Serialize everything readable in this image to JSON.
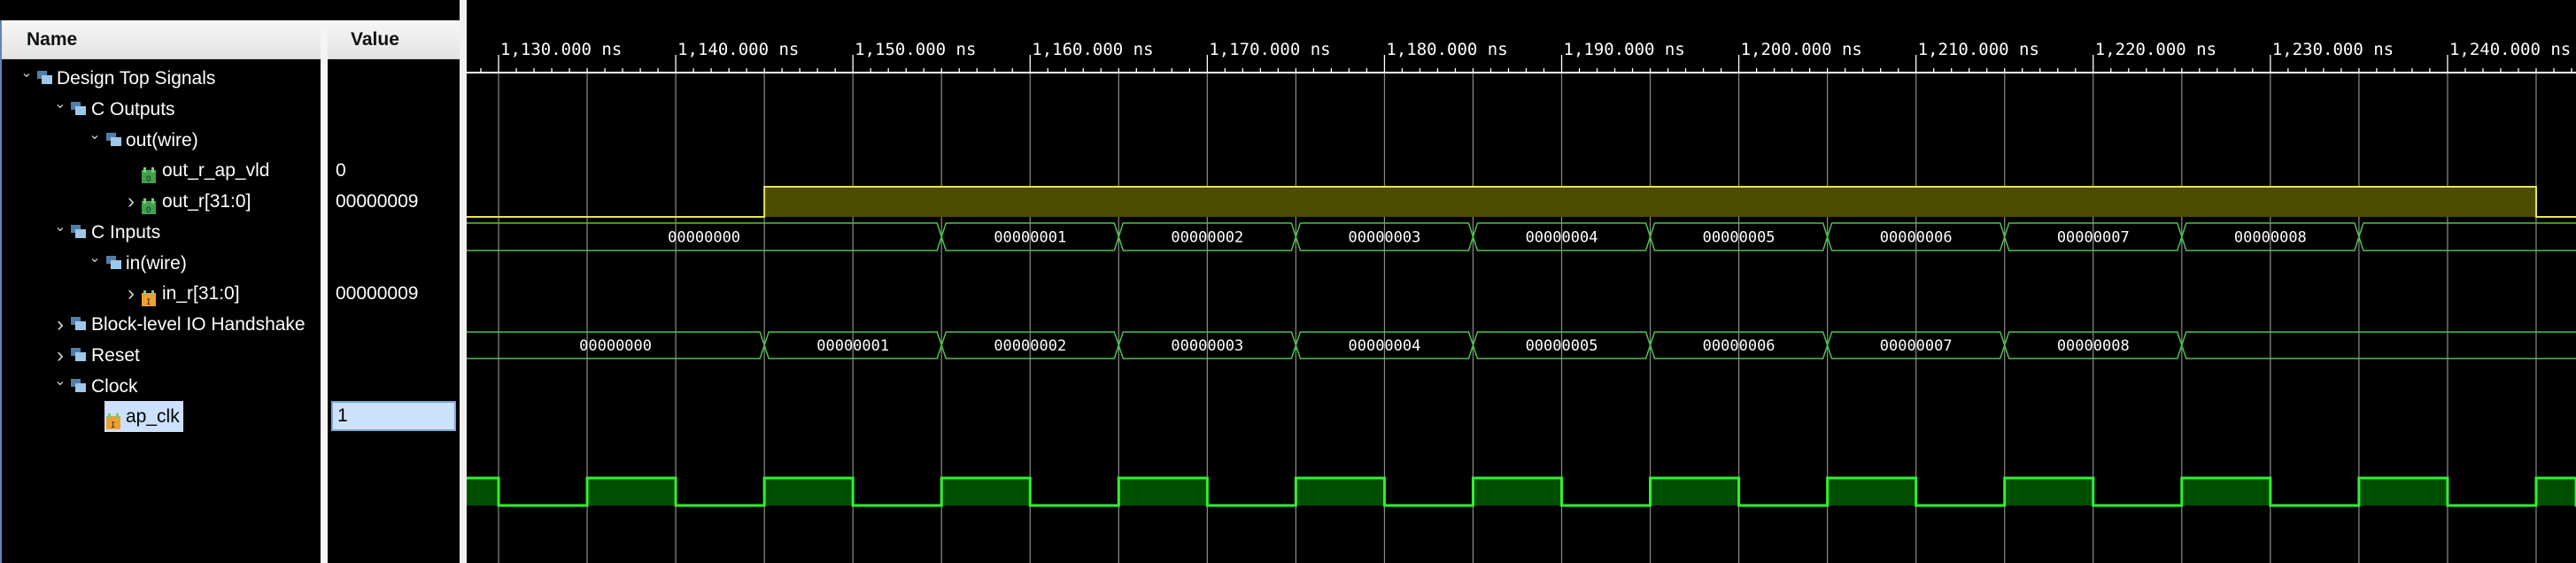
{
  "columns": {
    "name": "Name",
    "value": "Value"
  },
  "tree": [
    {
      "label": "Design Top Signals",
      "level": 0,
      "expander": "expanded",
      "icon": "group-icon"
    },
    {
      "label": "C Outputs",
      "level": 1,
      "expander": "expanded",
      "icon": "group-icon"
    },
    {
      "label": "out(wire)",
      "level": 2,
      "expander": "expanded",
      "icon": "group-icon"
    },
    {
      "label": "out_r_ap_vld",
      "level": 3,
      "expander": "none",
      "icon": "output-bit-icon",
      "value": "0"
    },
    {
      "label": "out_r[31:0]",
      "level": 3,
      "expander": "collapsed",
      "icon": "output-bus-icon",
      "value": "00000009"
    },
    {
      "label": "C Inputs",
      "level": 1,
      "expander": "expanded",
      "icon": "group-icon"
    },
    {
      "label": "in(wire)",
      "level": 2,
      "expander": "expanded",
      "icon": "group-icon"
    },
    {
      "label": "in_r[31:0]",
      "level": 3,
      "expander": "collapsed",
      "icon": "input-bus-icon",
      "value": "00000009"
    },
    {
      "label": "Block-level IO Handshake",
      "level": 1,
      "expander": "collapsed",
      "icon": "group-icon"
    },
    {
      "label": "Reset",
      "level": 1,
      "expander": "collapsed",
      "icon": "group-icon"
    },
    {
      "label": "Clock",
      "level": 1,
      "expander": "expanded",
      "icon": "group-icon"
    },
    {
      "label": "ap_clk",
      "level": 2,
      "expander": "none",
      "icon": "input-bit-icon",
      "value": "1",
      "selected": true
    }
  ],
  "waveform": {
    "visible_range_ns": [
      1128.2,
      1247.25
    ],
    "ruler_labels": [
      {
        "t": 1130,
        "text": "1,130.000 ns"
      },
      {
        "t": 1140,
        "text": "1,140.000 ns"
      },
      {
        "t": 1150,
        "text": "1,150.000 ns"
      },
      {
        "t": 1160,
        "text": "1,160.000 ns"
      },
      {
        "t": 1170,
        "text": "1,170.000 ns"
      },
      {
        "t": 1180,
        "text": "1,180.000 ns"
      },
      {
        "t": 1190,
        "text": "1,190.000 ns"
      },
      {
        "t": 1200,
        "text": "1,200.000 ns"
      },
      {
        "t": 1210,
        "text": "1,210.000 ns"
      },
      {
        "t": 1220,
        "text": "1,220.000 ns"
      },
      {
        "t": 1230,
        "text": "1,230.000 ns"
      },
      {
        "t": 1240,
        "text": "1,240.000 ns"
      }
    ],
    "out_r_ap_vld": {
      "initial": 0,
      "transitions": [
        {
          "t": 1145,
          "v": 1
        },
        {
          "t": 1245,
          "v": 0
        }
      ]
    },
    "out_r": [
      {
        "start": null,
        "label": "00000000"
      },
      {
        "start": 1155,
        "label": "00000001"
      },
      {
        "start": 1165,
        "label": "00000002"
      },
      {
        "start": 1175,
        "label": "00000003"
      },
      {
        "start": 1185,
        "label": "00000004"
      },
      {
        "start": 1195,
        "label": "00000005"
      },
      {
        "start": 1205,
        "label": "00000006"
      },
      {
        "start": 1215,
        "label": "00000007"
      },
      {
        "start": 1225,
        "label": "00000008"
      },
      {
        "start": 1235,
        "label": ""
      }
    ],
    "in_r": [
      {
        "start": null,
        "label": "00000000"
      },
      {
        "start": 1145,
        "label": "00000001"
      },
      {
        "start": 1155,
        "label": "00000002"
      },
      {
        "start": 1165,
        "label": "00000003"
      },
      {
        "start": 1175,
        "label": "00000004"
      },
      {
        "start": 1185,
        "label": "00000005"
      },
      {
        "start": 1195,
        "label": "00000006"
      },
      {
        "start": 1205,
        "label": "00000007"
      },
      {
        "start": 1215,
        "label": "00000008"
      },
      {
        "start": 1225,
        "label": ""
      }
    ],
    "ap_clk": {
      "period_ns": 10,
      "first_rising_ns": 1125,
      "duty": 0.5
    },
    "colors": {
      "bit_line": "#e6e65a",
      "bit_fill": "#4d4d00",
      "bus_line": "#4cc24c",
      "clk_line": "#33ee33",
      "clk_fill": "#004f00",
      "grid": "#8c8c8c"
    }
  }
}
